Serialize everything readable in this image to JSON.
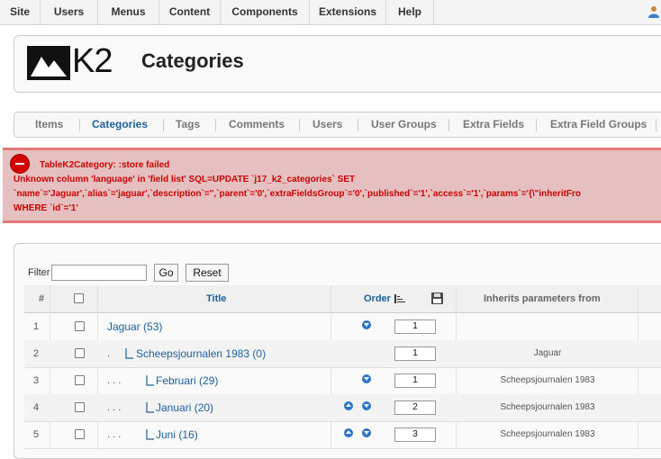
{
  "topmenu": {
    "items": [
      "Site",
      "Users",
      "Menus",
      "Content",
      "Components",
      "Extensions",
      "Help"
    ]
  },
  "header": {
    "logo_text": "K2",
    "title": "Categories"
  },
  "submenu": {
    "tabs": [
      "Items",
      "Categories",
      "Tags",
      "Comments",
      "Users",
      "User Groups",
      "Extra Fields",
      "Extra Field Groups"
    ],
    "active": "Categories"
  },
  "error": {
    "lines": [
      "TableK2Category: :store failed",
      "Unknown column 'language' in 'field list' SQL=UPDATE `j17_k2_categories` SET",
      "`name`='Jaguar',`alias`='jaguar',`description`='',`parent`='0',`extraFieldsGroup`='0',`published`='1',`access`='1',`params`='{\\\"inheritFro",
      "WHERE `id`='1'"
    ]
  },
  "filter": {
    "label": "Filter",
    "value": "",
    "go_label": "Go",
    "reset_label": "Reset"
  },
  "table": {
    "columns": {
      "num": "#",
      "title": "Title",
      "order": "Order",
      "inherits": "Inherits parameters from"
    },
    "rows": [
      {
        "num": "1",
        "prefix": "",
        "title": "Jaguar (53)",
        "order": "1",
        "inherits": ""
      },
      {
        "num": "2",
        "prefix": ".   ",
        "title": "Scheepsjournalen 1983 (0)",
        "order": "1",
        "inherits": "Jaguar"
      },
      {
        "num": "3",
        "prefix": ".   .   .",
        "title": "Februari (29)",
        "order": "1",
        "inherits": "Scheepsjournalen 1983"
      },
      {
        "num": "4",
        "prefix": ".   .   .",
        "title": "Januari (20)",
        "order": "2",
        "inherits": "Scheepsjournalen 1983"
      },
      {
        "num": "5",
        "prefix": ".   .   .",
        "title": "Juni (16)",
        "order": "3",
        "inherits": "Scheepsjournalen 1983"
      }
    ]
  }
}
